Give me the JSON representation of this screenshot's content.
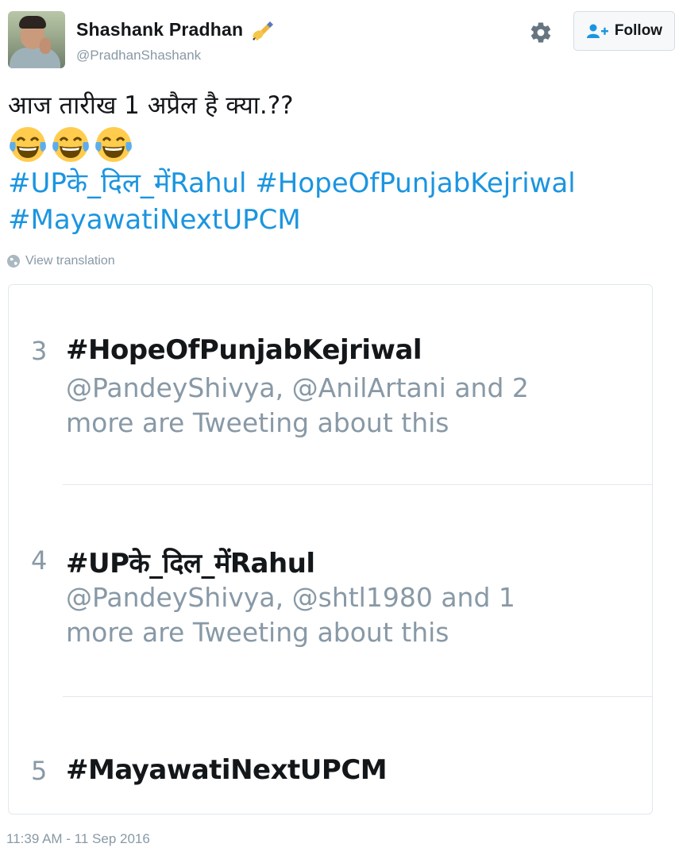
{
  "user": {
    "name": "Shashank Pradhan",
    "handle": "@PradhanShashank",
    "follow_label": "Follow",
    "pen_emoji": "writing-hand-icon"
  },
  "tweet": {
    "text": "आज तारीख 1 अप्रैल है क्या.??",
    "emoji_count": 3,
    "emoji_name": "face-with-tears-of-joy-icon",
    "hashtags": [
      "#UPके_दिल_मेंRahul",
      "#HopeOfPunjabKejriwal",
      "#MayawatiNextUPCM"
    ],
    "translate_label": "View translation",
    "timestamp": "11:39 AM - 11 Sep 2016"
  },
  "trends": [
    {
      "rank": "3",
      "tag": "#HopeOfPunjabKejriwal",
      "desc_line1": "@PandeyShivya, @AnilArtani and 2",
      "desc_line2": "more are Tweeting about this"
    },
    {
      "rank": "4",
      "tag": "#UPके_दिल_मेंRahul",
      "desc_line1": "@PandeyShivya, @shtl1980 and 1",
      "desc_line2": "more are Tweeting about this"
    },
    {
      "rank": "5",
      "tag": "#MayawatiNextUPCM"
    }
  ],
  "colors": {
    "link": "#1b95e0",
    "muted": "#8899a6",
    "text": "#14171a",
    "border": "#e1e8ed"
  }
}
